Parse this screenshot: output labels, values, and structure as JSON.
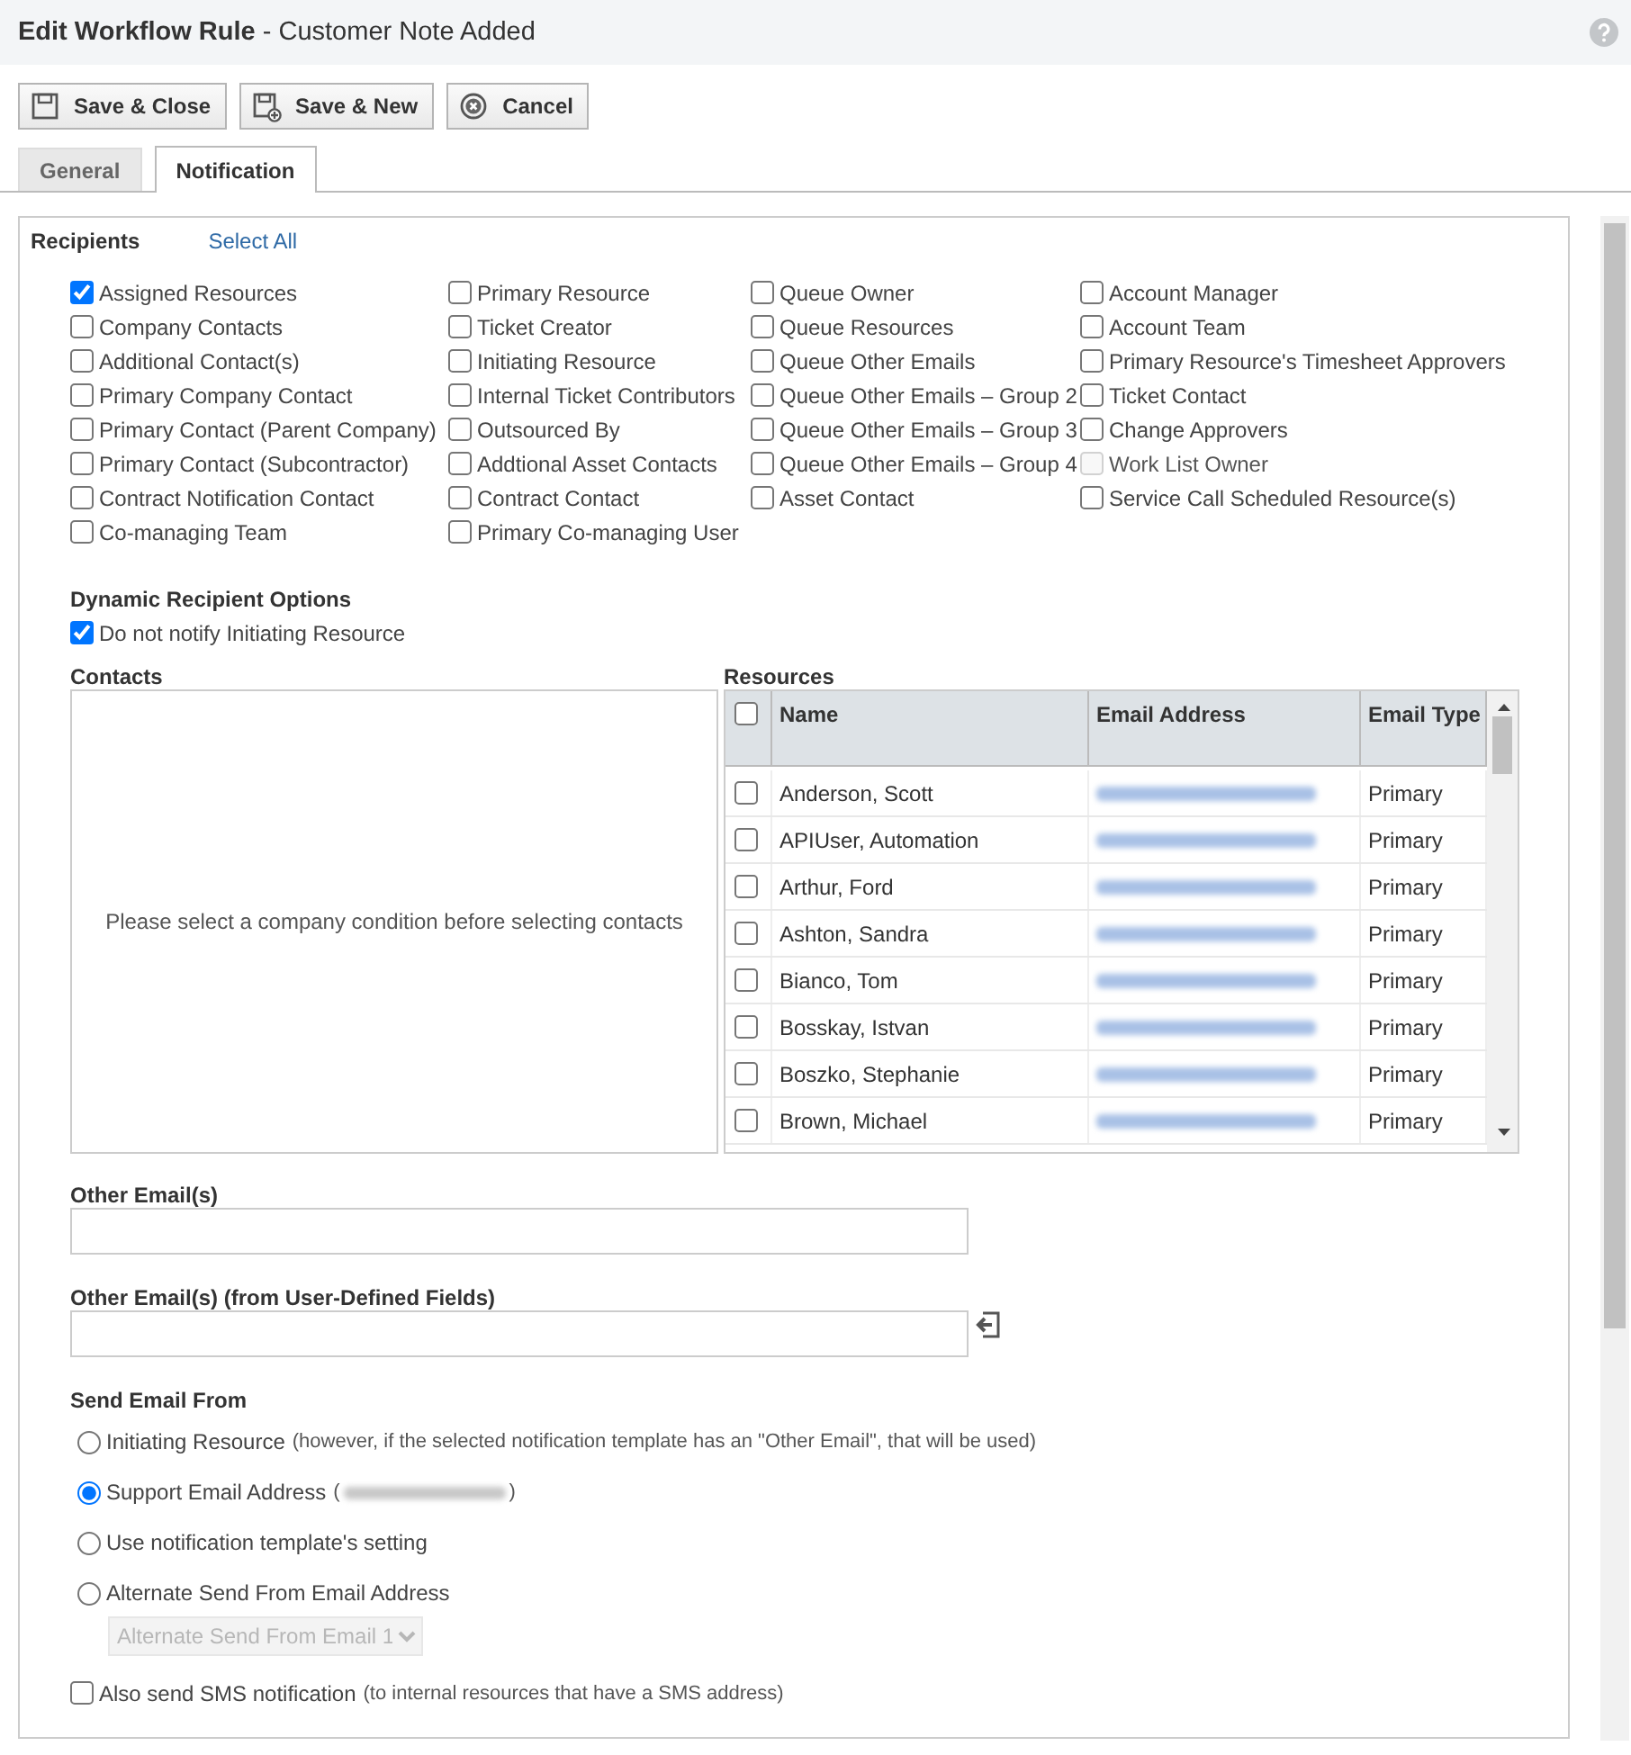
{
  "window": {
    "title": "**Edit Workflow Rule** - Customer Note Added"
  },
  "toolbar": [
    {
      "label": "Save & Close",
      "kind": "save"
    },
    {
      "label": "Save & New",
      "kind": "save-new"
    },
    {
      "label": "Cancel",
      "kind": "cancel"
    }
  ],
  "tabs": [
    {
      "label": "General",
      "selected": false
    },
    {
      "label": "Notification",
      "selected": true
    }
  ],
  "recipients": {
    "title": "Recipients",
    "select_all": "Select All",
    "columns": [
      [
        {
          "label": "Assigned Resources",
          "checked": true,
          "disabled": false
        },
        {
          "label": "Company Contacts",
          "checked": false,
          "disabled": false
        },
        {
          "label": "Additional Contact(s)",
          "checked": false,
          "disabled": false
        },
        {
          "label": "Primary Company Contact",
          "checked": false,
          "disabled": false
        },
        {
          "label": "Primary Contact (Parent Company)",
          "checked": false,
          "disabled": false
        },
        {
          "label": "Primary Contact (Subcontractor)",
          "checked": false,
          "disabled": false
        },
        {
          "label": "Contract Notification Contact",
          "checked": false,
          "disabled": false
        },
        {
          "label": "Co-managing Team",
          "checked": false,
          "disabled": false
        }
      ],
      [
        {
          "label": "Primary Resource",
          "checked": false,
          "disabled": false
        },
        {
          "label": "Ticket Creator",
          "checked": false,
          "disabled": false
        },
        {
          "label": "Initiating Resource",
          "checked": false,
          "disabled": false
        },
        {
          "label": "Internal Ticket Contributors",
          "checked": false,
          "disabled": false
        },
        {
          "label": "Outsourced By",
          "checked": false,
          "disabled": false
        },
        {
          "label": "Addtional Asset Contacts",
          "checked": false,
          "disabled": false
        },
        {
          "label": "Contract Contact",
          "checked": false,
          "disabled": false
        },
        {
          "label": "Primary Co-managing User",
          "checked": false,
          "disabled": false
        }
      ],
      [
        {
          "label": "Queue Owner",
          "checked": false,
          "disabled": false
        },
        {
          "label": "Queue Resources",
          "checked": false,
          "disabled": false
        },
        {
          "label": "Queue Other Emails",
          "checked": false,
          "disabled": false
        },
        {
          "label": "Queue Other Emails – Group 2",
          "checked": false,
          "disabled": false
        },
        {
          "label": "Queue Other Emails – Group 3",
          "checked": false,
          "disabled": false
        },
        {
          "label": "Queue Other Emails – Group 4",
          "checked": false,
          "disabled": false
        },
        {
          "label": "Asset Contact",
          "checked": false,
          "disabled": false
        }
      ],
      [
        {
          "label": "Account Manager",
          "checked": false,
          "disabled": false
        },
        {
          "label": "Account Team",
          "checked": false,
          "disabled": false
        },
        {
          "label": "Primary Resource's Timesheet Approvers",
          "checked": false,
          "disabled": false
        },
        {
          "label": "Ticket Contact",
          "checked": false,
          "disabled": false
        },
        {
          "label": "Change Approvers",
          "checked": false,
          "disabled": false
        },
        {
          "label": "Work List Owner",
          "checked": false,
          "disabled": true
        },
        {
          "label": "Service Call Scheduled Resource(s)",
          "checked": false,
          "disabled": false
        }
      ]
    ]
  },
  "dynamic": {
    "title": "Dynamic Recipient Options",
    "option": {
      "label": "Do not notify Initiating Resource",
      "checked": true
    }
  },
  "contacts": {
    "title": "Contacts",
    "message": "Please select a company condition before selecting contacts"
  },
  "resources": {
    "title": "Resources",
    "all_checked": false,
    "columns": [
      "Name",
      "Email Address",
      "Email Type"
    ],
    "rows": [
      {
        "name": "Anderson, Scott",
        "email_type": "Primary",
        "checked": false
      },
      {
        "name": "APIUser, Automation",
        "email_type": "Primary",
        "checked": false
      },
      {
        "name": "Arthur, Ford",
        "email_type": "Primary",
        "checked": false
      },
      {
        "name": "Ashton, Sandra",
        "email_type": "Primary",
        "checked": false
      },
      {
        "name": "Bianco, Tom",
        "email_type": "Primary",
        "checked": false
      },
      {
        "name": "Bosskay, Istvan",
        "email_type": "Primary",
        "checked": false
      },
      {
        "name": "Boszko, Stephanie",
        "email_type": "Primary",
        "checked": false
      },
      {
        "name": "Brown, Michael",
        "email_type": "Primary",
        "checked": false
      }
    ]
  },
  "other_emails": {
    "label": "Other Email(s)"
  },
  "udf_emails": {
    "label": "Other Email(s) (from User-Defined Fields)"
  },
  "send_from": {
    "title": "Send Email From",
    "options": [
      {
        "kind": "plain",
        "label": "Initiating Resource",
        "note": "(however, if the selected notification template has an \"Other Email\", that will be used)",
        "selected": false
      },
      {
        "kind": "redacted",
        "label": "Support Email Address",
        "note_before": "(",
        "note_after": ")",
        "selected": true
      },
      {
        "kind": "plain",
        "label": "Use notification template's setting",
        "selected": false
      },
      {
        "kind": "plain",
        "label": "Alternate Send From Email Address",
        "selected": false
      }
    ],
    "dropdown": {
      "value": "Alternate Send From Email 1",
      "disabled": true
    }
  },
  "sms": {
    "label": "Also send SMS notification",
    "note": "(to internal resources that have a SMS address)",
    "checked": false
  }
}
